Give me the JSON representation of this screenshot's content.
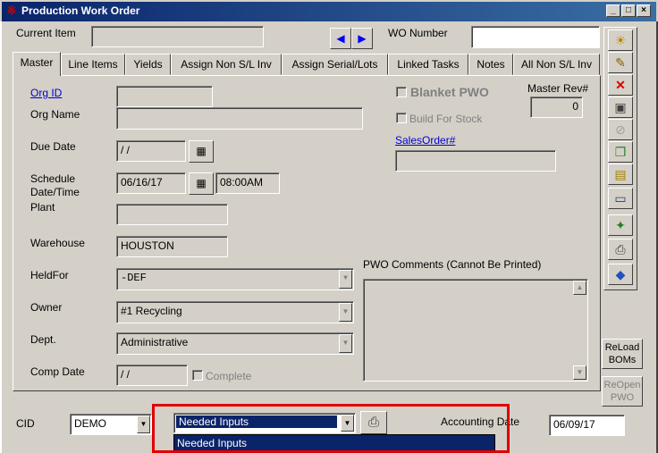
{
  "window": {
    "title": "Production Work Order",
    "app_icon": "app-icon",
    "min_label": "_",
    "max_label": "□",
    "close_label": "×"
  },
  "header": {
    "current_item_label": "Current Item",
    "current_item_value": "",
    "wo_number_label": "WO Number",
    "wo_number_value": ""
  },
  "tabs": [
    "Master",
    "Line Items",
    "Yields",
    "Assign  Non S/L Inv",
    "Assign Serial/Lots",
    "Linked Tasks",
    "Notes",
    "All Non S/L Inv"
  ],
  "master": {
    "org_id_label": "Org ID",
    "org_id_value": "",
    "org_name_label": "Org Name",
    "org_name_value": "",
    "due_date_label": "Due Date",
    "due_date_value": " / /",
    "schedule_label_1": "Schedule",
    "schedule_label_2": "Date/Time",
    "schedule_date": "06/16/17",
    "schedule_time": "08:00AM",
    "plant_label": "Plant",
    "plant_value": "",
    "warehouse_label": "Warehouse",
    "warehouse_value": "HOUSTON",
    "heldfor_label": "HeldFor",
    "heldfor_value": "-DEF",
    "owner_label": "Owner",
    "owner_value": "#1 Recycling",
    "dept_label": "Dept.",
    "dept_value": "Administrative",
    "comp_date_label": "Comp Date",
    "comp_date_value": " / /",
    "complete_label": "Complete",
    "blanket_label": "Blanket PWO",
    "build_for_stock_label": "Build For Stock",
    "master_rev_label": "Master Rev#",
    "master_rev_value": "0",
    "sales_order_label": "SalesOrder#",
    "sales_order_value": "",
    "pwo_comments_label": "PWO Comments  (Cannot Be Printed)"
  },
  "side_buttons": {
    "reload_1": "ReLoad",
    "reload_2": "BOMs",
    "reopen_1": "ReOpen",
    "reopen_2": "PWO"
  },
  "footer": {
    "cid_label": "CID",
    "cid_value": "DEMO",
    "report_value": "Needed Inputs",
    "report_options": [
      "Needed Inputs"
    ],
    "accounting_date_label": "Accounting Date",
    "accounting_date_value": "06/09/17"
  },
  "colors": {
    "title_bar": "#0a246a",
    "selection": "#0a246a",
    "highlight_box": "#e00000",
    "link": "#0000cc"
  }
}
